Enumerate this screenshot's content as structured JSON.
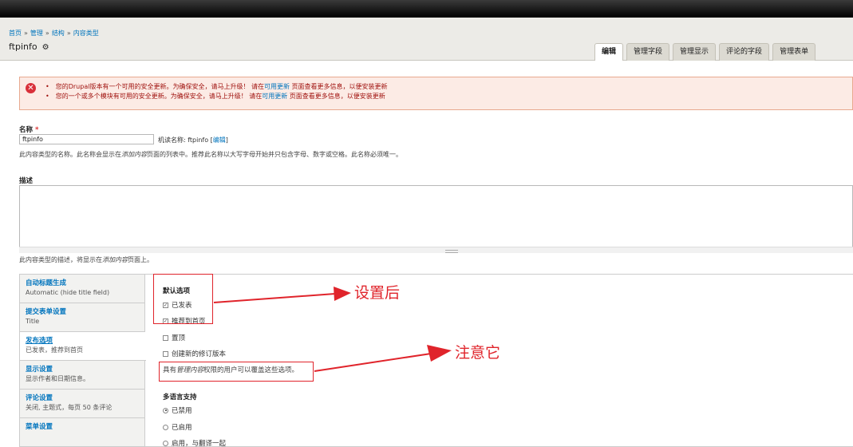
{
  "breadcrumb": [
    "首页",
    "管理",
    "结构",
    "内容类型"
  ],
  "breadcrumb_sep": "»",
  "page": {
    "title": "ftpinfo",
    "gear_glyph": "⚙"
  },
  "tabs": [
    "编辑",
    "管理字段",
    "管理显示",
    "评论的字段",
    "管理表单"
  ],
  "active_tab": "编辑",
  "messages": {
    "line1": {
      "pre": "您的Drupal版本有一个可用的安全更新。为确保安全，请马上升级！ 请在",
      "link": "可用更新",
      "post": " 页面查看更多信息，以便安装更新"
    },
    "line2": {
      "pre": "您的一个或多个模块有可用的安全更新。为确保安全，请马上升级！ 请在",
      "link": "可用更新",
      "post": " 页面查看更多信息，以便安装更新"
    }
  },
  "name_field": {
    "label": "名称",
    "required_mark": "*",
    "value": "ftpinfo",
    "machine_name_prefix": "机读名称: ftpinfo [",
    "machine_name_link": "编辑",
    "machine_name_suffix": "]",
    "help_pre": "此内容类型的名称。此名称会显示在",
    "help_em": "添加内容",
    "help_post": "页面的列表中。推荐此名称以大写字母开始并只包含字母、数字或空格。此名称必须唯一。"
  },
  "description_field": {
    "label": "描述",
    "help_pre": "此内容类型的描述，将显示在",
    "help_em": "添加内容",
    "help_post": "页面上。"
  },
  "vertical_tabs": [
    {
      "title": "自动标题生成",
      "summary": "Automatic (hide title field)"
    },
    {
      "title": "提交表单设置",
      "summary": "Title"
    },
    {
      "title": "发布选项",
      "summary": "已发表，推荐到首页"
    },
    {
      "title": "显示设置",
      "summary": "显示作者和日期信息。"
    },
    {
      "title": "评论设置",
      "summary": "关闭, 主题式，每页 50 条评论"
    },
    {
      "title": "菜单设置",
      "summary": ""
    }
  ],
  "selected_vtab": "发布选项",
  "publishing": {
    "heading": "默认选项",
    "options": [
      {
        "label": "已发表",
        "checked": true
      },
      {
        "label": "推荐到首页",
        "checked": true
      },
      {
        "label": "置顶",
        "checked": false
      },
      {
        "label": "创建新的修订版本",
        "checked": false
      }
    ],
    "note_pre": "具有",
    "note_em": "管理内容",
    "note_post": "权限的用户可以覆盖这些选项。"
  },
  "multilingual": {
    "heading": "多语言支持",
    "options": [
      {
        "label": "已禁用",
        "selected": true
      },
      {
        "label": "已启用",
        "selected": false
      },
      {
        "label": "启用，与翻译一起",
        "selected": false
      }
    ]
  },
  "annotations": {
    "after_setting": "设置后",
    "note_this": "注意它"
  },
  "colors": {
    "annotation_red": "#e0242b",
    "link_blue": "#0074bd",
    "error_bg": "#fcebe5"
  },
  "icons": {
    "error": "error-icon",
    "settings": "gear-icon",
    "check": "check-icon"
  }
}
